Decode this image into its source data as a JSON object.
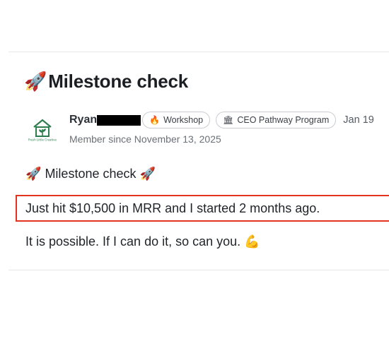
{
  "post": {
    "title": "Milestone check",
    "title_icon": "rocket-icon",
    "author": {
      "name": "Ryan",
      "avatar_icon": "house-plant-logo-icon",
      "avatar_text": "Fresh Little Creative",
      "member_since": "Member since November 13, 2025"
    },
    "badges": [
      {
        "icon": "🔥",
        "label": "Workshop"
      },
      {
        "icon": "🏛",
        "label": "CEO Pathway Program"
      }
    ],
    "date": "Jan 19",
    "body": {
      "line1": "Milestone check",
      "line1_icon": "rocket-icon",
      "line2": "Just hit $10,500 in MRR and I started 2 months ago.",
      "line3": "It is possible. If I can do it, so can you.",
      "line3_icon": "flexed-biceps-icon"
    }
  },
  "colors": {
    "highlight_border": "#e2331f",
    "brand_green": "#2e7d4f"
  }
}
